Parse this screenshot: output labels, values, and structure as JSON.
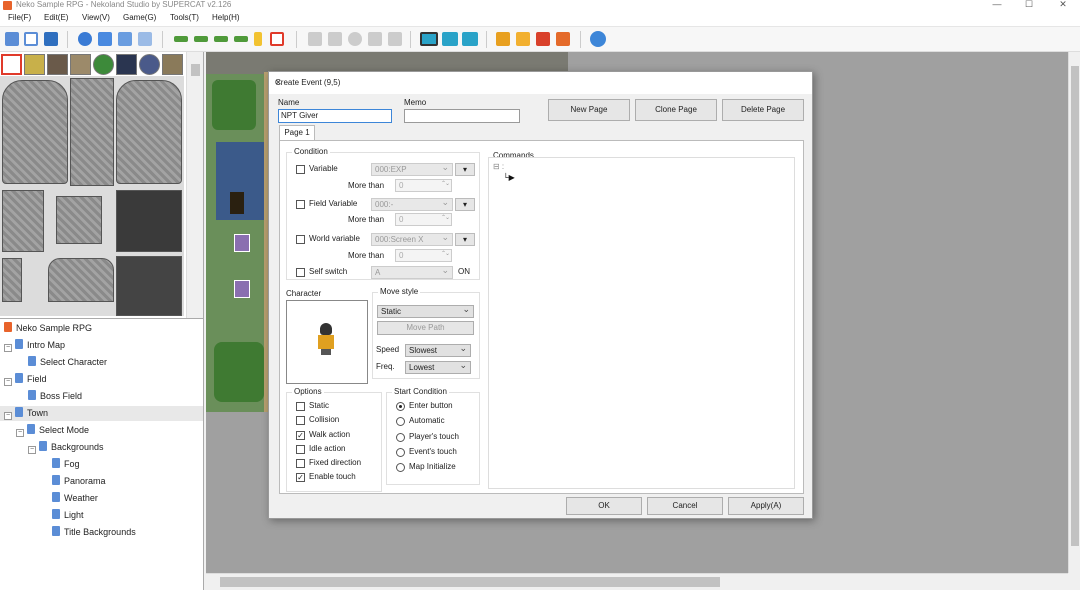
{
  "window": {
    "title": "Neko Sample RPG - Nekoland Studio by SUPERCAT v2.126",
    "minimize": "—",
    "maximize": "☐",
    "close": "✕"
  },
  "menu": {
    "items": [
      "File(F)",
      "Edit(E)",
      "View(V)",
      "Game(G)",
      "Tools(T)",
      "Help(H)"
    ]
  },
  "tree": {
    "root": "Neko Sample RPG",
    "nodes": [
      "Intro Map",
      "Select Character",
      "Field",
      "Boss Field",
      "Town",
      "Select Mode",
      "Backgrounds",
      "Fog",
      "Panorama",
      "Weather",
      "Light",
      "Title Backgrounds"
    ]
  },
  "dialog": {
    "title": "Create Event (9,5)",
    "close": "✕",
    "name_label": "Name",
    "name_value": "NPT Giver",
    "memo_label": "Memo",
    "memo_value": "",
    "new_page": "New Page",
    "clone_page": "Clone Page",
    "delete_page": "Delete Page",
    "tab": "Page 1",
    "condition": {
      "title": "Condition",
      "variable": "Variable",
      "variable_value": "000:EXP",
      "more_than": "More than",
      "spin_value": "0",
      "field_variable": "Field Variable",
      "field_variable_value": "000:-",
      "world_variable": "World variable",
      "world_variable_value": "000:Screen X",
      "self_switch": "Self switch",
      "self_switch_value": "A",
      "on": "ON",
      "small_btn": "▾"
    },
    "character": {
      "title": "Character"
    },
    "move_style": {
      "title": "Move style",
      "type": "Static",
      "move_path": "Move Path",
      "speed_label": "Speed",
      "speed": "Slowest",
      "freq_label": "Freq.",
      "freq": "Lowest"
    },
    "options": {
      "title": "Options",
      "items": [
        {
          "label": "Static",
          "checked": false
        },
        {
          "label": "Collision",
          "checked": false
        },
        {
          "label": "Walk action",
          "checked": true
        },
        {
          "label": "Idle action",
          "checked": false
        },
        {
          "label": "Fixed direction",
          "checked": false
        },
        {
          "label": "Enable touch",
          "checked": true
        }
      ]
    },
    "start_condition": {
      "title": "Start Condition",
      "items": [
        "Enter button",
        "Automatic",
        "Player's touch",
        "Event's touch",
        "Map Initialize"
      ],
      "selected": 0
    },
    "commands": {
      "title": "Commands",
      "tree_prefix": "⊟ :",
      "cursor": "└▶"
    },
    "ok": "OK",
    "cancel": "Cancel",
    "apply": "Apply(A)"
  },
  "colors": {
    "accent": "#3d86d8",
    "app_icon": "#e8632b",
    "folder": "#5b8dd6"
  }
}
